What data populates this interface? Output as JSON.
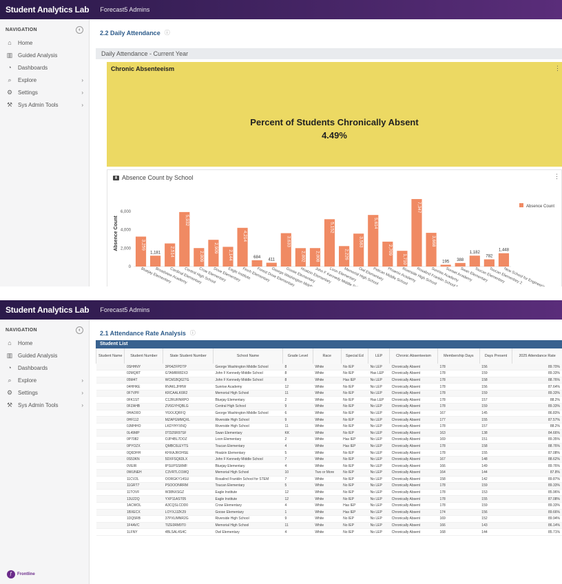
{
  "app": {
    "title": "Student Analytics Lab",
    "tenant": "Forecast5 Admins"
  },
  "nav": {
    "heading": "NAVIGATION",
    "collapse_icon": "chevron-left-icon",
    "items": [
      {
        "label": "Home",
        "icon": "home-icon",
        "chevron": false
      },
      {
        "label": "Guided Analysis",
        "icon": "bar-chart-icon",
        "chevron": false
      },
      {
        "label": "Dashboards",
        "icon": "gauge-icon",
        "chevron": false
      },
      {
        "label": "Explore",
        "icon": "search-icon",
        "chevron": true
      },
      {
        "label": "Settings",
        "icon": "gear-icon",
        "chevron": true
      },
      {
        "label": "Sys Admin Tools",
        "icon": "tools-icon",
        "chevron": true
      }
    ]
  },
  "screen1": {
    "page_title": "2.2 Daily Attendance",
    "subheader": "Daily Attendance - Current Year",
    "kpi": {
      "header": "Chronic Absenteeism",
      "title": "Percent of Students Chronically Absent",
      "value": "4.49%",
      "color": "#ecd963"
    },
    "chart_panel_title": "Absence Count by School"
  },
  "chart_data": {
    "type": "bar",
    "xlabel": "School Name",
    "ylabel": "Absence Count",
    "ylim": [
      0,
      7500
    ],
    "yticks": [
      0,
      2000,
      4000,
      6000
    ],
    "ytick_labels": [
      "0",
      "2,000",
      "4,000",
      "6,000"
    ],
    "bar_color": "#f08a63",
    "series": [
      {
        "name": "Absence Count",
        "values": [
          3259,
          1181,
          2514,
          5932,
          2009,
          2909,
          2144,
          4214,
          684,
          411,
          3633,
          2002,
          2008,
          5152,
          2226,
          3583,
          5614,
          2709,
          1710,
          7347,
          3668,
          195,
          388,
          1182,
          782,
          1448
        ]
      }
    ],
    "data_labels": [
      "3,259",
      "1,181",
      "2,514",
      "5,932",
      "2,009",
      "2,909",
      "2,144",
      "4,214",
      "684",
      "411",
      "3,633",
      "2,002",
      "2,008",
      "5,152",
      "2,226",
      "3,583",
      "5,614",
      "2,709",
      "1,710",
      "7,347",
      "3,668",
      "195",
      "388",
      "1,182",
      "782",
      "1,448"
    ],
    "categories": [
      "Bluejay Elementary",
      "Broadview Academy",
      "Cardinal Elementary",
      "Central High School",
      "Crow Elementary",
      "Dove Elementary",
      "Eagle Institute",
      "Finch Elementary",
      "Forest Dove Elementary",
      "George Washington Middle School",
      "Goose Elementary",
      "Hoatzin Elementary",
      "John F Kennedy Middle School",
      "Loon Elementary",
      "Memorial High School",
      "Owl Elementary",
      "Pelican Middle School",
      "Phoenix Academy",
      "Riverside High School",
      "Rosalind Franklin School for STEM",
      "Sunrise Academy",
      "Sunset Academy",
      "Swan Elementary",
      "Toucan Elementary",
      "Toucan Elementary 2",
      "New School for Engineering"
    ],
    "legend": "top-right",
    "grid": false
  },
  "screen2": {
    "page_title": "2.1 Attendance Rate Analysis",
    "list_title": "Student List",
    "columns": [
      "Student Name",
      "Student Number",
      "State Student Number",
      "School Name",
      "Grade Level",
      "Race",
      "Special Ed",
      "LEP",
      "Chronic Absenteeism",
      "Membership Days",
      "Days Present",
      "2025 Attendance Rate"
    ],
    "rows": [
      [
        "",
        "0SHHNY",
        "3P04ZFPDTP",
        "George Washington Middle School",
        "8",
        "White",
        "No IEP",
        "No LEP",
        "Chronically Absent",
        "178",
        "156",
        "89.70%"
      ],
      [
        "",
        "02MQRT",
        "GTAMRR82X3",
        "John F Kennedy Middle School",
        "8",
        "White",
        "No IEP",
        "Has LEP",
        "Chronically Absent",
        "178",
        "159",
        "89.33%"
      ],
      [
        "",
        "05M4T",
        "WCM1BQ627G",
        "John F Kennedy Middle School",
        "8",
        "White",
        "Has IEP",
        "No LEP",
        "Chronically Absent",
        "178",
        "158",
        "88.76%"
      ],
      [
        "",
        "04HHKE",
        "RVAKLJHHW",
        "Sunrise Academy",
        "12",
        "White",
        "No IEP",
        "No LEP",
        "Chronically Absent",
        "178",
        "156",
        "87.64%"
      ],
      [
        "",
        "0F7VPF",
        "KRCAALK6R2",
        "Memorial High School",
        "11",
        "White",
        "No IEP",
        "No LEP",
        "Chronically Absent",
        "178",
        "159",
        "89.33%"
      ],
      [
        "",
        "0FK1ST",
        "C12RURNRPO",
        "Bluejay Elementary",
        "2",
        "White",
        "No IEP",
        "Has LEP",
        "Chronically Absent",
        "178",
        "157",
        "88.2%"
      ],
      [
        "",
        "0FZAHB",
        "ZV6GYHQBLG",
        "Central High School",
        "9",
        "White",
        "No IEP",
        "No LEP",
        "Chronically Absent",
        "178",
        "159",
        "89.33%"
      ],
      [
        "",
        "0HAO0O",
        "Y6XXJQRFQ",
        "George Washington Middle School",
        "6",
        "White",
        "No IEP",
        "No LEP",
        "Chronically Absent",
        "167",
        "145",
        "86.83%"
      ],
      [
        "",
        "0HF112",
        "MZAPGMMQXL",
        "Riverside High School",
        "9",
        "White",
        "No IEP",
        "No LEP",
        "Chronically Absent",
        "177",
        "155",
        "87.57%"
      ],
      [
        "",
        "0JMHHO",
        "LKDYHYXNQ",
        "Riverside High School",
        "11",
        "White",
        "No IEP",
        "No LEP",
        "Chronically Absent",
        "178",
        "157",
        "88.2%"
      ],
      [
        "",
        "0L49MP",
        "0TDZ6R97SF",
        "Swan Elementary",
        "KK",
        "White",
        "No IEP",
        "No LEP",
        "Chronically Absent",
        "163",
        "138",
        "84.66%"
      ],
      [
        "",
        "0P7082",
        "OJP4BL7DOZ",
        "Loon Elementary",
        "2",
        "White",
        "Has IEP",
        "No LEP",
        "Chronically Absent",
        "169",
        "151",
        "89.35%"
      ],
      [
        "",
        "0PYOZX",
        "QMBC6LEYTS",
        "Toucan Elementary",
        "4",
        "White",
        "Has IEP",
        "No LEP",
        "Chronically Absent",
        "178",
        "158",
        "88.76%"
      ],
      [
        "",
        "0Q6DHH",
        "KHXAJROHSE",
        "Hoatzin Elementary",
        "5",
        "White",
        "No IEP",
        "No LEP",
        "Chronically Absent",
        "178",
        "155",
        "87.08%"
      ],
      [
        "",
        "0S53KN",
        "5DXFSQ6DLX",
        "John F Kennedy Middle School",
        "7",
        "White",
        "No IEP",
        "No LEP",
        "Chronically Absent",
        "167",
        "148",
        "88.62%"
      ],
      [
        "",
        "0VEIR",
        "IPSUPSSRMF",
        "Bluejay Elementary",
        "4",
        "White",
        "No IEP",
        "No LEP",
        "Chronically Absent",
        "166",
        "149",
        "89.76%"
      ],
      [
        "",
        "0WUNEH",
        "C3VRTLO1WQ",
        "Memorial High School",
        "10",
        "Two or More",
        "No IEP",
        "No LEP",
        "Chronically Absent",
        "164",
        "144",
        "87.8%"
      ],
      [
        "",
        "11CV2L",
        "OORGKY14SU",
        "Rosalind Franklin School for STEM",
        "7",
        "White",
        "No IEP",
        "No LEP",
        "Chronically Absent",
        "158",
        "142",
        "89.87%"
      ],
      [
        "",
        "11GRT7",
        "PSOOONRRM",
        "Toucan Elementary",
        "5",
        "White",
        "No IEP",
        "No LEP",
        "Chronically Absent",
        "178",
        "159",
        "89.33%"
      ],
      [
        "",
        "11TOVF",
        "W38NXSGZ",
        "Eagle Institute",
        "12",
        "White",
        "No IEP",
        "No LEP",
        "Chronically Absent",
        "178",
        "153",
        "85.96%"
      ],
      [
        "",
        "13U22Q",
        "YXP11AST05",
        "Eagle Institute",
        "12",
        "White",
        "No IEP",
        "No LEP",
        "Chronically Absent",
        "178",
        "155",
        "87.08%"
      ],
      [
        "",
        "1ACWOL",
        "A3CQSLCDD0",
        "Crow Elementary",
        "4",
        "White",
        "Has IEP",
        "No LEP",
        "Chronically Absent",
        "178",
        "159",
        "89.33%"
      ],
      [
        "",
        "1BXECX",
        "LOYXJJZK29",
        "Goose Elementary",
        "1",
        "White",
        "Has IEP",
        "No LEP",
        "Chronically Absent",
        "174",
        "156",
        "89.66%"
      ],
      [
        "",
        "1DQ5RB",
        "37PXUMNR2G",
        "Riverside High School",
        "9",
        "White",
        "No IEP",
        "No LEP",
        "Chronically Absent",
        "169",
        "152",
        "89.94%"
      ],
      [
        "",
        "1F4AVC",
        "TIZE0RM9T0",
        "Memorial High School",
        "11",
        "White",
        "No IEP",
        "No LEP",
        "Chronically Absent",
        "166",
        "143",
        "86.14%"
      ],
      [
        "",
        "1LFNY",
        "4BLSAL4S4C",
        "Owl Elementary",
        "4",
        "White",
        "No IEP",
        "No LEP",
        "Chronically Absent",
        "168",
        "144",
        "85.71%"
      ]
    ]
  },
  "logo": {
    "text": "Frontline"
  },
  "colors": {
    "topbar": "#4a2468",
    "accent": "#38618f",
    "bar": "#f08a63",
    "kpi": "#ecd963"
  }
}
